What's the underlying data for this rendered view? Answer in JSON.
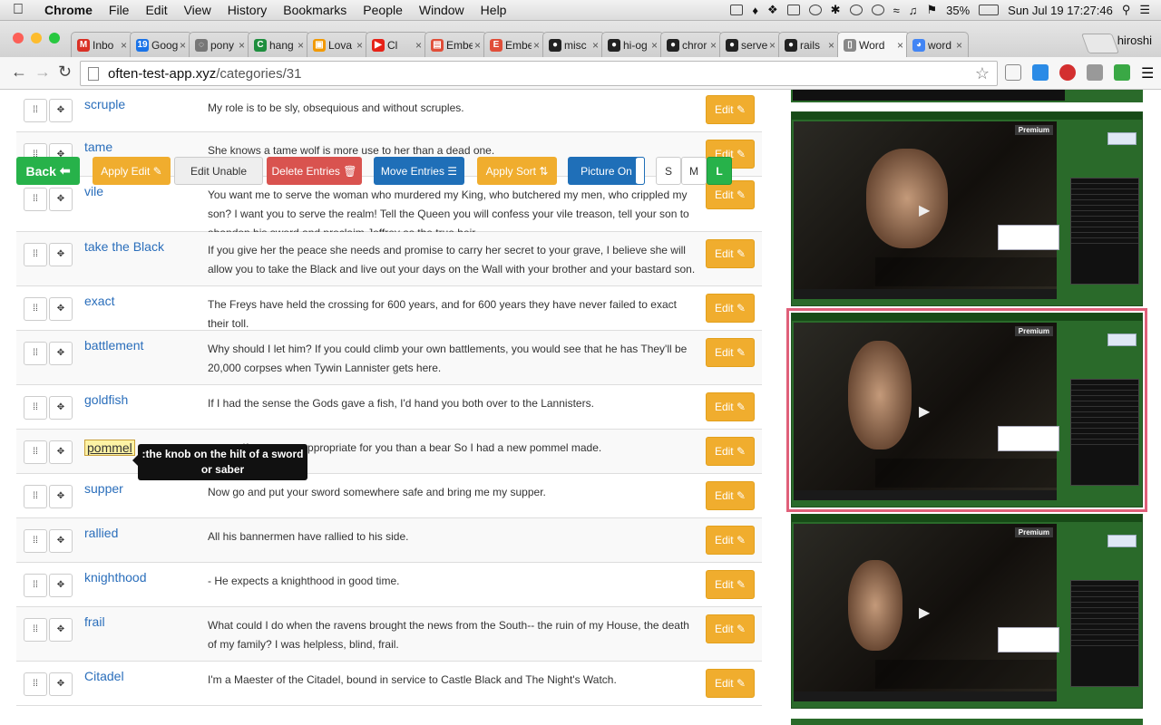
{
  "menubar": {
    "app_name": "Chrome",
    "items": [
      "File",
      "Edit",
      "View",
      "History",
      "Bookmarks",
      "People",
      "Window",
      "Help"
    ],
    "battery": "35%",
    "datetime": "Sun Jul 19  17:27:46"
  },
  "tabs": [
    {
      "label": "Inbo",
      "icon": "gmail-icon",
      "color": "#d93025",
      "glyph": "M"
    },
    {
      "label": "Goog",
      "icon": "google-calendar-icon",
      "color": "#1a73e8",
      "glyph": "19"
    },
    {
      "label": "pony",
      "icon": "generic-icon",
      "color": "#777",
      "glyph": "◌"
    },
    {
      "label": "hang",
      "icon": "hangouts-icon",
      "color": "#1e8e3e",
      "glyph": "C"
    },
    {
      "label": "Lova",
      "icon": "lovable-icon",
      "color": "#f29900",
      "glyph": "▣"
    },
    {
      "label": "Cl",
      "icon": "youtube-icon",
      "color": "#e62117",
      "glyph": "▶"
    },
    {
      "label": "Embe",
      "icon": "ember-icon",
      "color": "#e04e39",
      "glyph": "▤"
    },
    {
      "label": "Embe",
      "icon": "ember-icon",
      "color": "#e04e39",
      "glyph": "E"
    },
    {
      "label": "misc",
      "icon": "github-icon",
      "color": "#222",
      "glyph": "●"
    },
    {
      "label": "hi-og",
      "icon": "github-icon",
      "color": "#222",
      "glyph": "●"
    },
    {
      "label": "chror",
      "icon": "github-icon",
      "color": "#222",
      "glyph": "●"
    },
    {
      "label": "serve",
      "icon": "github-icon",
      "color": "#222",
      "glyph": "●"
    },
    {
      "label": "rails",
      "icon": "github-icon",
      "color": "#222",
      "glyph": "●"
    },
    {
      "label": "Word",
      "icon": "page-icon",
      "color": "#888",
      "glyph": "▯",
      "active": true
    },
    {
      "label": "word",
      "icon": "chrome-icon",
      "color": "#4285f4",
      "glyph": "◕"
    }
  ],
  "profile_name": "hiroshi",
  "omnibox": {
    "host": "often-test-app.xyz",
    "path": "/categories/31"
  },
  "toolbar": {
    "back": "Back",
    "apply_edit": "Apply Edit",
    "edit_unable": "Edit Unable",
    "delete_entries": "Delete Entries",
    "move_entries": "Move Entries",
    "apply_sort": "Apply Sort",
    "picture_on": "Picture On",
    "size_s": "S",
    "size_m": "M",
    "size_l": "L"
  },
  "edit_label": "Edit",
  "rows": [
    {
      "word": "scruple",
      "sentence": "My role is to be sly, obsequious and without scruples."
    },
    {
      "word": "tame",
      "sentence": "She knows a tame wolf is more use to her than a dead one."
    },
    {
      "word": "vile",
      "sentence": "You want me to serve the woman who murdered my King, who butchered my men, who crippled my son? I want you to serve the realm! Tell the Queen you will confess your vile treason, tell your son to abandon his sword and proclaim Joffrey as the true heir."
    },
    {
      "word": "take the Black",
      "sentence": "If you give her the peace she needs and promise to carry her secret to your grave, I believe she will allow you to take the Black and live out your days on the Wall with your brother and your bastard son."
    },
    {
      "word": "exact",
      "sentence": "The Freys have held the crossing for 600 years, and for 600 years they have never failed to exact their toll."
    },
    {
      "word": "battlement",
      "sentence": "Why should I let him? If you could climb your own battlements, you would see that he has They'll be 20,000 corpses when Tywin Lannister gets here."
    },
    {
      "word": "goldfish",
      "sentence": "If I had the sense the Gods gave a fish, I'd hand you both over to the Lannisters."
    },
    {
      "word": "pommel",
      "sentence": "... a wolf was more appropriate for you than a bear So I had a new pommel made."
    },
    {
      "word": "supper",
      "sentence": "Now go and put your sword somewhere safe and bring me my supper."
    },
    {
      "word": "rallied",
      "sentence": "All his bannermen have rallied to his side."
    },
    {
      "word": "knighthood",
      "sentence": "- He expects a knighthood in good time."
    },
    {
      "word": "frail",
      "sentence": "What could I do when the ravens brought the news from the South-- the ruin of my House, the death of my family? I was helpless, blind, frail."
    },
    {
      "word": "Citadel",
      "sentence": "I'm a Maester of the Citadel, bound in service to Castle Black and The Night's Watch."
    }
  ],
  "tooltip": ":the knob on the hilt of a sword or saber",
  "cards": [
    {
      "premium": "Premium",
      "selected": false
    },
    {
      "premium": "Premium",
      "selected": true
    },
    {
      "premium": "Premium",
      "selected": false
    }
  ],
  "colors": {
    "link": "#2a6ebb",
    "edit": "#f0ad2e",
    "back": "#27b24a",
    "delete": "#d9534f",
    "move": "#1f6fb8",
    "picture": "#1f6fb8",
    "card_bg": "#2a6a2a",
    "selected_outline": "#e0607a"
  }
}
